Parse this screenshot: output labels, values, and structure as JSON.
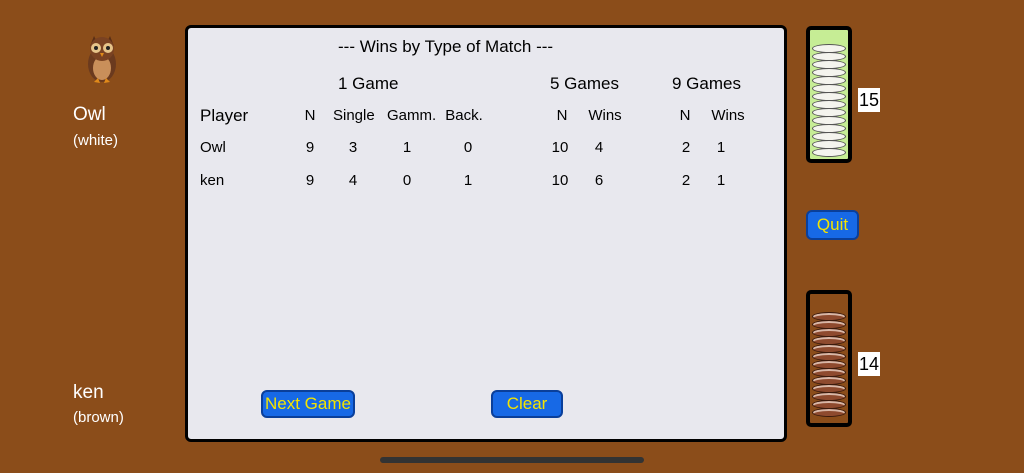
{
  "players": {
    "top": {
      "name": "Owl",
      "color": "(white)"
    },
    "bottom": {
      "name": "ken",
      "color": "(brown)"
    }
  },
  "stats": {
    "title": "--- Wins by Type of Match ---",
    "groups": {
      "one_game": "1 Game",
      "five_games": "5 Games",
      "nine_games": "9 Games"
    },
    "headers": {
      "player": "Player",
      "n1": "N",
      "single": "Single",
      "gammon": "Gamm.",
      "back": "Back.",
      "n5": "N",
      "wins5": "Wins",
      "n9": "N",
      "wins9": "Wins"
    },
    "rows": [
      {
        "player": "Owl",
        "n1": "9",
        "single": "3",
        "gammon": "1",
        "back": "0",
        "n5": "10",
        "wins5": "4",
        "n9": "2",
        "wins9": "1"
      },
      {
        "player": "ken",
        "n1": "9",
        "single": "4",
        "gammon": "0",
        "back": "1",
        "n5": "10",
        "wins5": "6",
        "n9": "2",
        "wins9": "1"
      }
    ],
    "buttons": {
      "next_game": "Next Game",
      "clear": "Clear"
    }
  },
  "side": {
    "white_count": "15",
    "brown_count": "14",
    "quit": "Quit"
  },
  "colors": {
    "background": "#8b4d1a",
    "button": "#1769e6",
    "button_text": "#f4e400",
    "white_tray": "#c6ed95"
  }
}
